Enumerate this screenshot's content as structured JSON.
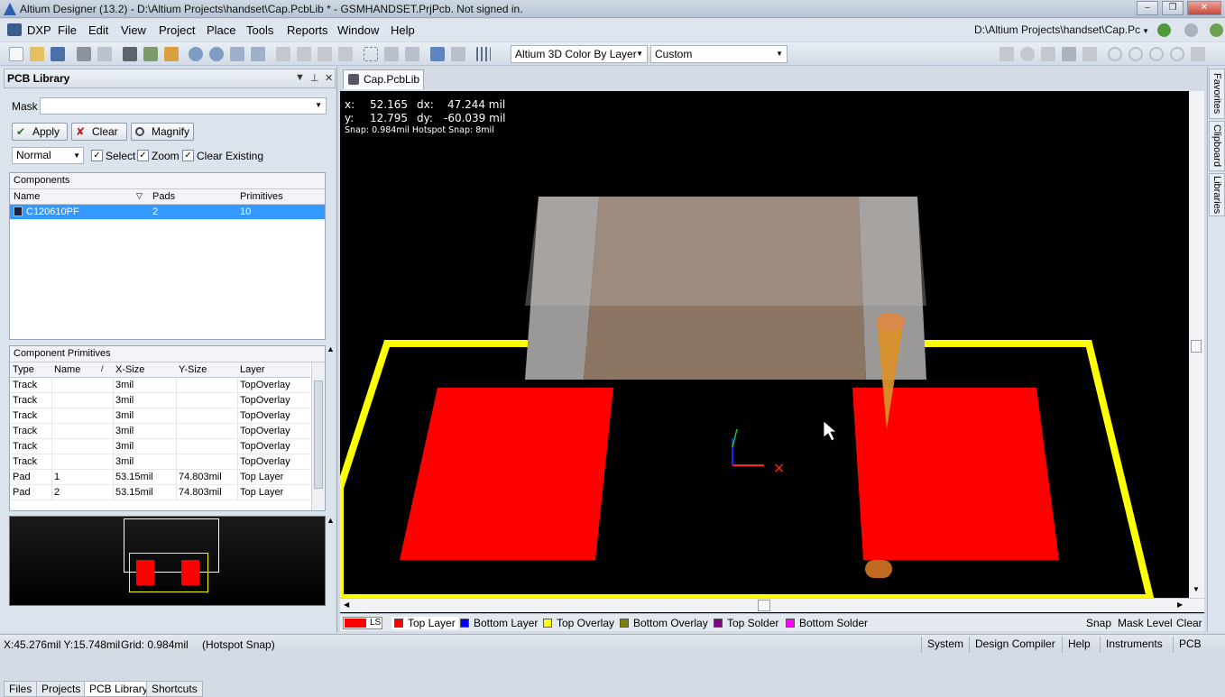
{
  "window": {
    "title": "Altium Designer (13.2) - D:\\Altium Projects\\handset\\Cap.PcbLib * - GSMHANDSET.PrjPcb. Not signed in.",
    "minimize": "–",
    "restore": "❐",
    "close": "✕"
  },
  "menu": [
    "DXP",
    "File",
    "Edit",
    "View",
    "Project",
    "Place",
    "Tools",
    "Reports",
    "Window",
    "Help"
  ],
  "path_box": "D:\\Altium Projects\\handset\\Cap.Pc",
  "toolbar": {
    "view_mode": "Altium 3D Color By Layer",
    "view_config": "Custom"
  },
  "panel": {
    "title": "PCB Library",
    "mask_label": "Mask",
    "mask_value": "",
    "apply": "Apply",
    "clear": "Clear",
    "magnify": "Magnify",
    "filter_mode": "Normal",
    "select": "Select",
    "zoom": "Zoom",
    "clear_existing": "Clear Existing",
    "components_title": "Components",
    "components_headers": [
      "Name",
      "Pads",
      "Primitives"
    ],
    "components": [
      {
        "name": "C120610PF",
        "pads": "2",
        "primitives": "10"
      }
    ],
    "primitives_title": "Component Primitives",
    "primitives_headers": [
      "Type",
      "Name",
      "X-Size",
      "Y-Size",
      "Layer"
    ],
    "primitives": [
      {
        "type": "Track",
        "name": "",
        "xsize": "3mil",
        "ysize": "",
        "layer": "TopOverlay"
      },
      {
        "type": "Track",
        "name": "",
        "xsize": "3mil",
        "ysize": "",
        "layer": "TopOverlay"
      },
      {
        "type": "Track",
        "name": "",
        "xsize": "3mil",
        "ysize": "",
        "layer": "TopOverlay"
      },
      {
        "type": "Track",
        "name": "",
        "xsize": "3mil",
        "ysize": "",
        "layer": "TopOverlay"
      },
      {
        "type": "Track",
        "name": "",
        "xsize": "3mil",
        "ysize": "",
        "layer": "TopOverlay"
      },
      {
        "type": "Track",
        "name": "",
        "xsize": "3mil",
        "ysize": "",
        "layer": "TopOverlay"
      },
      {
        "type": "Pad",
        "name": "1",
        "xsize": "53.15mil",
        "ysize": "74.803mil",
        "layer": "Top Layer"
      },
      {
        "type": "Pad",
        "name": "2",
        "xsize": "53.15mil",
        "ysize": "74.803mil",
        "layer": "Top Layer"
      }
    ],
    "tabs": [
      "Files",
      "Projects",
      "PCB Library",
      "Shortcuts"
    ]
  },
  "document_tab": "Cap.PcbLib *",
  "readout": {
    "x_label": "x:",
    "x": "52.165",
    "dx_label": "dx:",
    "dx": "47.244 mil",
    "y_label": "y:",
    "y": "12.795",
    "dy_label": "dy:",
    "dy": "-60.039 mil",
    "snap": "Snap: 0.984mil Hotspot Snap: 8mil"
  },
  "layers": {
    "ls": "LS",
    "items": [
      {
        "name": "Top Layer",
        "color": "#ff0000"
      },
      {
        "name": "Bottom Layer",
        "color": "#0000ff"
      },
      {
        "name": "Top Overlay",
        "color": "#ffff00"
      },
      {
        "name": "Bottom Overlay",
        "color": "#808000"
      },
      {
        "name": "Top Solder",
        "color": "#800080"
      },
      {
        "name": "Bottom Solder",
        "color": "#ff00ff"
      }
    ],
    "snap": "Snap",
    "mask_level": "Mask Level",
    "clear": "Clear"
  },
  "right_tabs": [
    "Favorites",
    "Clipboard",
    "Libraries"
  ],
  "status": {
    "coords": "X:45.276mil Y:15.748mil",
    "grid": "Grid: 0.984mil",
    "snap": "(Hotspot Snap)",
    "buttons": [
      "System",
      "Design Compiler",
      "Help",
      "Instruments",
      "PCB"
    ]
  }
}
